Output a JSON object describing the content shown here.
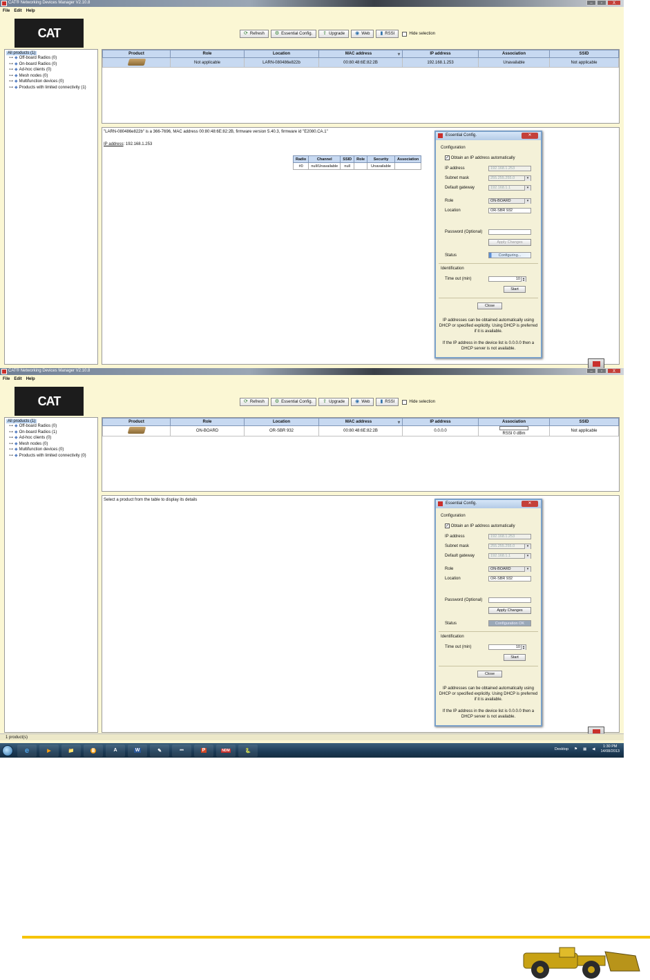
{
  "app": {
    "window_title": "CAT® Networking Devices Manager V2.10.8",
    "window_buttons": [
      "–",
      "▫",
      "X"
    ],
    "menu": [
      "File",
      "Edit",
      "Help"
    ],
    "logo_text": "CAT",
    "toolbar": {
      "refresh": "Refresh",
      "essential": "Essential Config.",
      "upgrade": "Upgrade",
      "web": "Web",
      "rssi": "RSSI",
      "hide_selection": "Hide selection"
    },
    "tree": {
      "root": "All products (1)",
      "items": [
        "Off-board Radios (0)",
        "On-board Radios (0)",
        "Ad-hoc clients (0)",
        "Mesh nodes (0)",
        "Multifunction devices (0)",
        "Products with limited connectivity (1)"
      ],
      "items2": [
        "Off-board Radios (0)",
        "On-board Radios (1)",
        "Ad-hoc clients (0)",
        "Mesh nodes (0)",
        "Multifunction devices (0)",
        "Products with limited connectivity (0)"
      ]
    },
    "table_headers": [
      "Product",
      "Role",
      "Location",
      "MAC address",
      "IP address",
      "Association",
      "SSID"
    ],
    "row1": {
      "role": "Not applicable",
      "location": "LARN-080486e822b",
      "mac": "00:80:48:6E:82:2B",
      "ip": "192.168.1.253",
      "association": "Unavailable",
      "ssid": "Not applicable"
    },
    "row2": {
      "role": "ON-BOARD",
      "location": "OR-SBR 932",
      "mac": "00:80:48:6E:82:2B",
      "ip": "0.0.0.0",
      "association": "RSSI 0 dBm",
      "ssid": "Not applicable"
    },
    "details1": {
      "line1": "\"LARN-080486e822b\" is a 366-7696, MAC address 00:80:48:6E:82:2B, firmware version 5.40.3, firmware id \"E2080.CA.1\"",
      "ip_label": "IP address",
      "ip_value": ": 192.168.1.253",
      "radio_headers": [
        "Radio",
        "Channel",
        "SSID",
        "Role",
        "Security",
        "Association"
      ],
      "radio_row": [
        "#0",
        "null/Unavailable",
        "null",
        "",
        "Unavailable",
        ""
      ]
    },
    "details2": {
      "line1": "Select a product from the table to display its details"
    },
    "dialog": {
      "title": "Essential Config.",
      "configuration": "Configuration",
      "obtain_auto": "Obtain an IP address automatically",
      "ip_label": "IP address",
      "ip_value": "192.168.1.253",
      "mask_label": "Subnet mask",
      "mask_value": "255.255.255.0",
      "gw_label": "Default gateway",
      "gw_value": "192.168.1.1",
      "role_label": "Role",
      "role_value": "ON-BOARD",
      "location_label": "Location",
      "location_value": "OR-SBR 932",
      "password_label": "Password (Optional)",
      "apply": "Apply Changes",
      "status_label": "Status",
      "status_configuring": "Configuring...",
      "status_ok": "Configuration OK",
      "identification": "Identification",
      "timeout_label": "Time out (min)",
      "timeout_value": "10",
      "start": "Start",
      "close": "Close",
      "help1": "IP addresses can be obtained automatically using DHCP or specified explicitly. Using DHCP is preferred if it is available.",
      "help2": "If the IP address in the device list is 0.0.0.0 then a DHCP server is not available."
    },
    "status_text": "1 product(s)",
    "taskbar": {
      "desktop": "Desktop",
      "time": "1:30 PM",
      "date": "14/08/2013",
      "apps": [
        "e",
        "▶",
        "📁",
        "ⅲ",
        "A",
        "W",
        "✎",
        "⎓",
        "P",
        "NDM",
        "🐍"
      ]
    },
    "colors": {
      "accent": "#f6c400",
      "panel_bg": "#fbf7d4",
      "header_blue": "#c7d9f1"
    }
  }
}
